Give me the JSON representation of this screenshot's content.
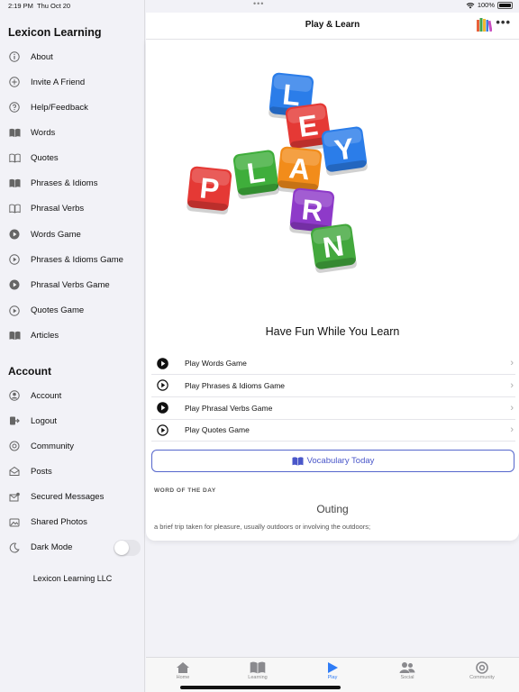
{
  "status": {
    "time": "2:19 PM",
    "date": "Thu Oct 20",
    "battery": "100%"
  },
  "sidebar": {
    "title": "Lexicon Learning",
    "items": [
      {
        "label": "About",
        "icon": "info-icon"
      },
      {
        "label": "Invite A Friend",
        "icon": "plus-circle-icon"
      },
      {
        "label": "Help/Feedback",
        "icon": "question-circle-icon"
      },
      {
        "label": "Words",
        "icon": "book-filled-icon"
      },
      {
        "label": "Quotes",
        "icon": "book-outline-icon"
      },
      {
        "label": "Phrases & Idioms",
        "icon": "book-filled-icon"
      },
      {
        "label": "Phrasal Verbs",
        "icon": "book-outline-icon"
      },
      {
        "label": "Words Game",
        "icon": "play-circle-filled-icon"
      },
      {
        "label": "Phrases & Idioms Game",
        "icon": "play-circle-outline-icon"
      },
      {
        "label": "Phrasal Verbs Game",
        "icon": "play-circle-filled-icon"
      },
      {
        "label": "Quotes Game",
        "icon": "play-circle-outline-icon"
      },
      {
        "label": "Articles",
        "icon": "book-filled-icon"
      }
    ],
    "account_title": "Account",
    "account_items": [
      {
        "label": "Account",
        "icon": "person-circle-icon"
      },
      {
        "label": "Logout",
        "icon": "logout-icon"
      },
      {
        "label": "Community",
        "icon": "at-icon"
      },
      {
        "label": "Posts",
        "icon": "envelope-open-icon"
      },
      {
        "label": "Secured Messages",
        "icon": "envelope-badge-icon"
      },
      {
        "label": "Shared Photos",
        "icon": "photo-icon"
      },
      {
        "label": "Dark Mode",
        "icon": "moon-icon"
      }
    ],
    "dark_mode_on": false,
    "footer": "Lexicon Learning LLC"
  },
  "main": {
    "nav_title": "Play & Learn",
    "hero_letters": {
      "play": [
        "P",
        "L",
        "A",
        "Y"
      ],
      "learn": [
        "L",
        "E",
        "A",
        "R",
        "N"
      ]
    },
    "headline": "Have Fun While You Learn",
    "games": [
      {
        "label": "Play Words Game",
        "filled": true
      },
      {
        "label": "Play Phrases & Idioms Game",
        "filled": false
      },
      {
        "label": "Play Phrasal Verbs Game",
        "filled": true
      },
      {
        "label": "Play Quotes Game",
        "filled": false
      }
    ],
    "vocab_button": "Vocabulary Today",
    "word_of_day_label": "WORD OF THE DAY",
    "word": "Outing",
    "definition": "a brief trip taken for pleasure, usually outdoors or involving the outdoors;"
  },
  "tabs": [
    {
      "label": "Home",
      "icon": "house-icon",
      "active": false
    },
    {
      "label": "Learning",
      "icon": "book-icon",
      "active": false
    },
    {
      "label": "Play",
      "icon": "play-icon",
      "active": true
    },
    {
      "label": "Social",
      "icon": "people-icon",
      "active": false
    },
    {
      "label": "Community",
      "icon": "at-icon",
      "active": false
    }
  ],
  "colors": {
    "accent": "#2f7cf6",
    "button_border": "#5566cc"
  }
}
